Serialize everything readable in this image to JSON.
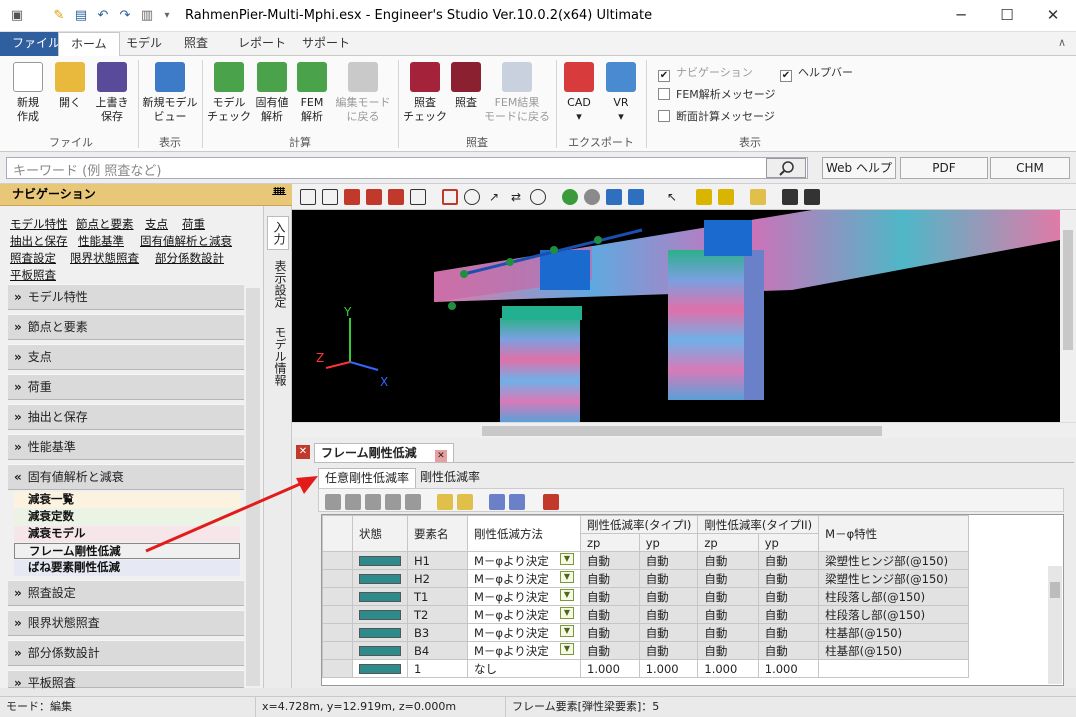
{
  "window": {
    "title": "RahmenPier-Multi-Mphi.esx - Engineer's Studio Ver.10.0.2(x64) Ultimate",
    "minimize": "─",
    "maximize": "☐",
    "close": "✕"
  },
  "ribbon_tabs": [
    "ファイル",
    "ホーム",
    "モデル",
    "照査",
    "レポート",
    "サポート"
  ],
  "ribbon": {
    "buttons": [
      {
        "l1": "新規",
        "l2": "作成",
        "icon": "new-file-icon"
      },
      {
        "l1": "開く",
        "l2": "",
        "icon": "open-folder-icon"
      },
      {
        "l1": "上書き",
        "l2": "保存",
        "icon": "save-icon"
      },
      {
        "l1": "新規モデル",
        "l2": "ビュー",
        "icon": "model-view-icon"
      },
      {
        "l1": "モデル",
        "l2": "チェック",
        "icon": "model-check-icon"
      },
      {
        "l1": "固有値",
        "l2": "解析",
        "icon": "eigen-analysis-icon"
      },
      {
        "l1": "FEM",
        "l2": "解析",
        "icon": "fem-analysis-icon"
      },
      {
        "l1": "編集モード",
        "l2": "に戻る",
        "icon": "edit-mode-icon"
      },
      {
        "l1": "照査",
        "l2": "チェック",
        "icon": "verify-check-icon"
      },
      {
        "l1": "照査",
        "l2": "",
        "icon": "verify-icon"
      },
      {
        "l1": "FEM結果",
        "l2": "モードに戻る",
        "icon": "fem-result-icon"
      },
      {
        "l1": "CAD",
        "l2": "▾",
        "icon": "cad-export-icon"
      },
      {
        "l1": "VR",
        "l2": "▾",
        "icon": "vr-export-icon"
      }
    ],
    "groups": [
      "ファイル",
      "表示",
      "計算",
      "照査",
      "エクスポート",
      "表示"
    ],
    "checks": [
      {
        "label": "ナビゲーション",
        "checked": "✔"
      },
      {
        "label": "FEM解析メッセージ",
        "checked": ""
      },
      {
        "label": "断面計算メッセージ",
        "checked": ""
      },
      {
        "label": "ヘルプバー",
        "checked": "✔"
      }
    ]
  },
  "search": {
    "placeholder": "キーワード (例 照査など)",
    "web_help": "Web ヘルプ",
    "pdf": "PDF",
    "chm": "CHM"
  },
  "nav": {
    "title": "ナビゲーション",
    "pin": "ᚙ",
    "links": [
      "モデル特性",
      "節点と要素",
      "支点",
      "荷重",
      "抽出と保存",
      "性能基準",
      "固有値解析と減衰",
      "照査設定",
      "限界状態照査",
      "部分係数設計",
      "平板照査"
    ],
    "sections": [
      "モデル特性",
      "節点と要素",
      "支点",
      "荷重",
      "抽出と保存",
      "性能基準",
      "固有値解析と減衰",
      "照査設定",
      "限界状態照査",
      "部分係数設計",
      "平板照査"
    ],
    "expanded_items": [
      "減衰一覧",
      "減衰定数",
      "減衰モデル",
      "フレーム剛性低減",
      "ばね要素剛性低減"
    ],
    "side_tabs": [
      "入力",
      "表示設定",
      "モデル情報"
    ]
  },
  "axes": {
    "x": "X",
    "y": "Y",
    "z": "Z"
  },
  "panel": {
    "title": "フレーム剛性低減",
    "tabs": [
      "任意剛性低減率",
      "剛性低減率"
    ],
    "headers": {
      "status": "状態",
      "name": "要素名",
      "method": "剛性低減方法",
      "rate1": "剛性低減率(タイプI)",
      "rate2": "剛性低減率(タイプII)",
      "zp": "zp",
      "yp": "yp",
      "mphi": "M－φ特性"
    },
    "rows": [
      {
        "name": "H1",
        "method": "M－φより決定",
        "zp1": "自動",
        "yp1": "自動",
        "zp2": "自動",
        "yp2": "自動",
        "mphi": "梁塑性ヒンジ部(@150)"
      },
      {
        "name": "H2",
        "method": "M－φより決定",
        "zp1": "自動",
        "yp1": "自動",
        "zp2": "自動",
        "yp2": "自動",
        "mphi": "梁塑性ヒンジ部(@150)"
      },
      {
        "name": "T1",
        "method": "M－φより決定",
        "zp1": "自動",
        "yp1": "自動",
        "zp2": "自動",
        "yp2": "自動",
        "mphi": "柱段落し部(@150)"
      },
      {
        "name": "T2",
        "method": "M－φより決定",
        "zp1": "自動",
        "yp1": "自動",
        "zp2": "自動",
        "yp2": "自動",
        "mphi": "柱段落し部(@150)"
      },
      {
        "name": "B3",
        "method": "M－φより決定",
        "zp1": "自動",
        "yp1": "自動",
        "zp2": "自動",
        "yp2": "自動",
        "mphi": "柱基部(@150)"
      },
      {
        "name": "B4",
        "method": "M－φより決定",
        "zp1": "自動",
        "yp1": "自動",
        "zp2": "自動",
        "yp2": "自動",
        "mphi": "柱基部(@150)"
      },
      {
        "name": "1",
        "method": "なし",
        "zp1": "1.000",
        "yp1": "1.000",
        "zp2": "1.000",
        "yp2": "1.000",
        "mphi": ""
      }
    ]
  },
  "statusbar": {
    "mode": "モード：編集",
    "coords": "x=4.728m, y=12.919m, z=0.000m",
    "element": "フレーム要素[弾性梁要素]：5"
  },
  "colors": {
    "file_tab": "#2f5f9f",
    "nav_header": "#e8c778",
    "status_teal": "#2e8b8b",
    "arrow_red": "#e21b1b"
  }
}
